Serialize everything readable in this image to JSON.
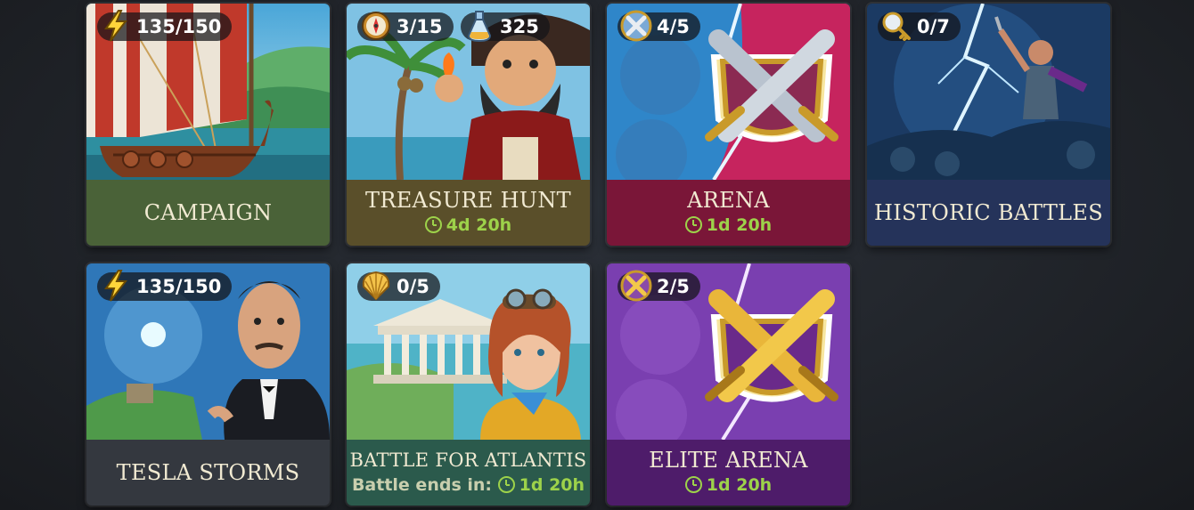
{
  "cards": [
    {
      "id": "campaign",
      "title": "CAMPAIGN",
      "label_color": "#4a6238",
      "badges": [
        {
          "icon": "energy-bolt-icon",
          "value": "135/150"
        }
      ]
    },
    {
      "id": "treasure-hunt",
      "title": "TREASURE HUNT",
      "label_color": "#5a4f2a",
      "timer": "4d 20h",
      "badges": [
        {
          "icon": "compass-icon",
          "value": "3/15"
        },
        {
          "icon": "potion-flask-icon",
          "value": "325"
        }
      ]
    },
    {
      "id": "arena",
      "title": "ARENA",
      "label_color": "#7a1638",
      "timer": "1d 20h",
      "badges": [
        {
          "icon": "crossed-swords-token-icon",
          "value": "4/5"
        }
      ]
    },
    {
      "id": "historic-battles",
      "title": "HISTORIC BATTLES",
      "label_color": "#25335a",
      "badges": [
        {
          "icon": "magnifier-key-icon",
          "value": "0/7"
        }
      ]
    },
    {
      "id": "tesla-storms",
      "title": "TESLA STORMS",
      "label_color": "#34383f",
      "badges": [
        {
          "icon": "energy-bolt-icon",
          "value": "135/150"
        }
      ]
    },
    {
      "id": "battle-for-atlantis",
      "title": "BATTLE FOR ATLANTIS",
      "label_color": "#2b5a4c",
      "timer_prefix": "Battle ends in:",
      "timer": "1d 20h",
      "badges": [
        {
          "icon": "seashell-icon",
          "value": "0/5"
        }
      ]
    },
    {
      "id": "elite-arena",
      "title": "ELITE ARENA",
      "label_color": "#4e1c6a",
      "timer": "1d 20h",
      "badges": [
        {
          "icon": "gold-crossed-swords-token-icon",
          "value": "2/5"
        }
      ]
    }
  ]
}
